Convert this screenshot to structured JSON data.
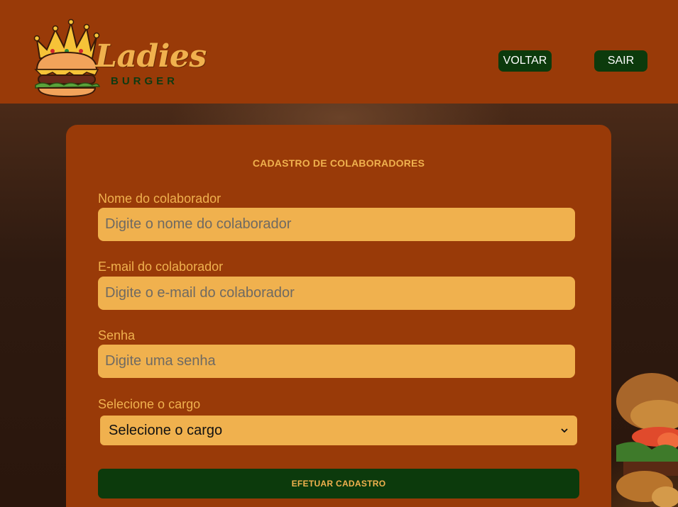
{
  "brand": {
    "name": "Ladies",
    "subtitle": "BURGER"
  },
  "nav": {
    "back_label": "VOLTAR",
    "logout_label": "SAIR"
  },
  "form": {
    "title": "CADASTRO DE COLABORADORES",
    "fields": [
      {
        "label": "Nome do colaborador",
        "placeholder": "Digite o nome do colaborador",
        "value": ""
      },
      {
        "label": "E-mail do colaborador",
        "placeholder": "Digite o e-mail do colaborador",
        "value": ""
      },
      {
        "label": "Senha",
        "placeholder": "Digite uma senha",
        "value": ""
      }
    ],
    "role": {
      "label": "Selecione o cargo",
      "selected": "Selecione o cargo"
    },
    "submit_label": "EFETUAR CADASTRO"
  },
  "colors": {
    "header_bg": "#993a08",
    "accent": "#f0b14e",
    "button_bg": "#0c3a0c"
  },
  "icons": {
    "logo": "crowned-burger-icon",
    "select": "chevron-down-icon"
  }
}
